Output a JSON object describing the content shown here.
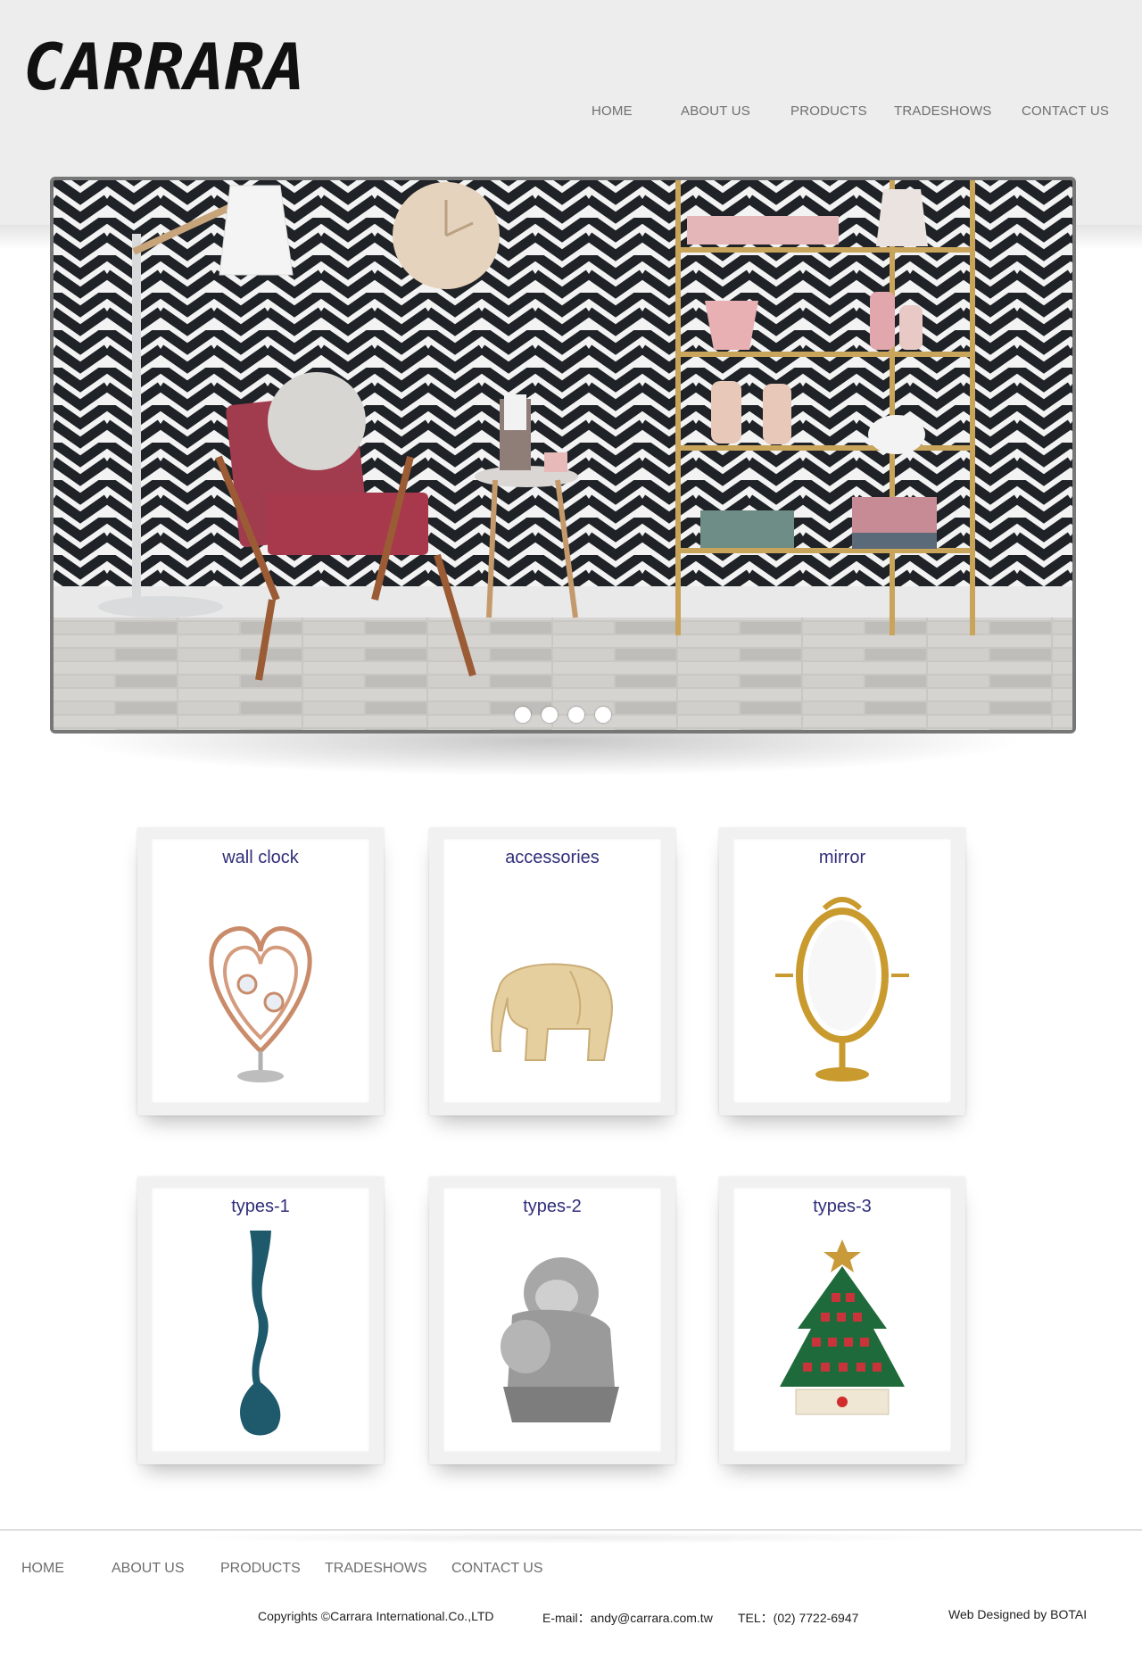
{
  "brand": {
    "logo_text": "CARRARA"
  },
  "nav": [
    {
      "label": "HOME"
    },
    {
      "label": "ABOUT US"
    },
    {
      "label": "PRODUCTS"
    },
    {
      "label": "TRADESHOWS"
    },
    {
      "label": "CONTACT US"
    }
  ],
  "hero": {
    "slide_count": 4,
    "active_slide": 1
  },
  "products": [
    {
      "title": "wall clock",
      "icon": "heart-ornament-icon"
    },
    {
      "title": "accessories",
      "icon": "wooden-elephant-icon"
    },
    {
      "title": "mirror",
      "icon": "gold-mirror-icon"
    },
    {
      "title": "types-1",
      "icon": "teal-vase-icon"
    },
    {
      "title": "types-2",
      "icon": "stone-lion-icon"
    },
    {
      "title": "types-3",
      "icon": "christmas-tree-calendar-icon"
    }
  ],
  "footer": {
    "nav": [
      {
        "label": "HOME"
      },
      {
        "label": "ABOUT US"
      },
      {
        "label": "PRODUCTS"
      },
      {
        "label": "TRADESHOWS"
      },
      {
        "label": "CONTACT US"
      }
    ],
    "copyright": "Copyrights ©Carrara International.Co.,LTD",
    "email": "E-mail：andy@carrara.com.tw",
    "tel": "TEL：(02) 7722-6947",
    "designer": "Web Designed by BOTAI"
  },
  "colors": {
    "header_bg": "#ededee",
    "nav_text": "#6e6e6e",
    "card_title": "#2f2e7a"
  }
}
